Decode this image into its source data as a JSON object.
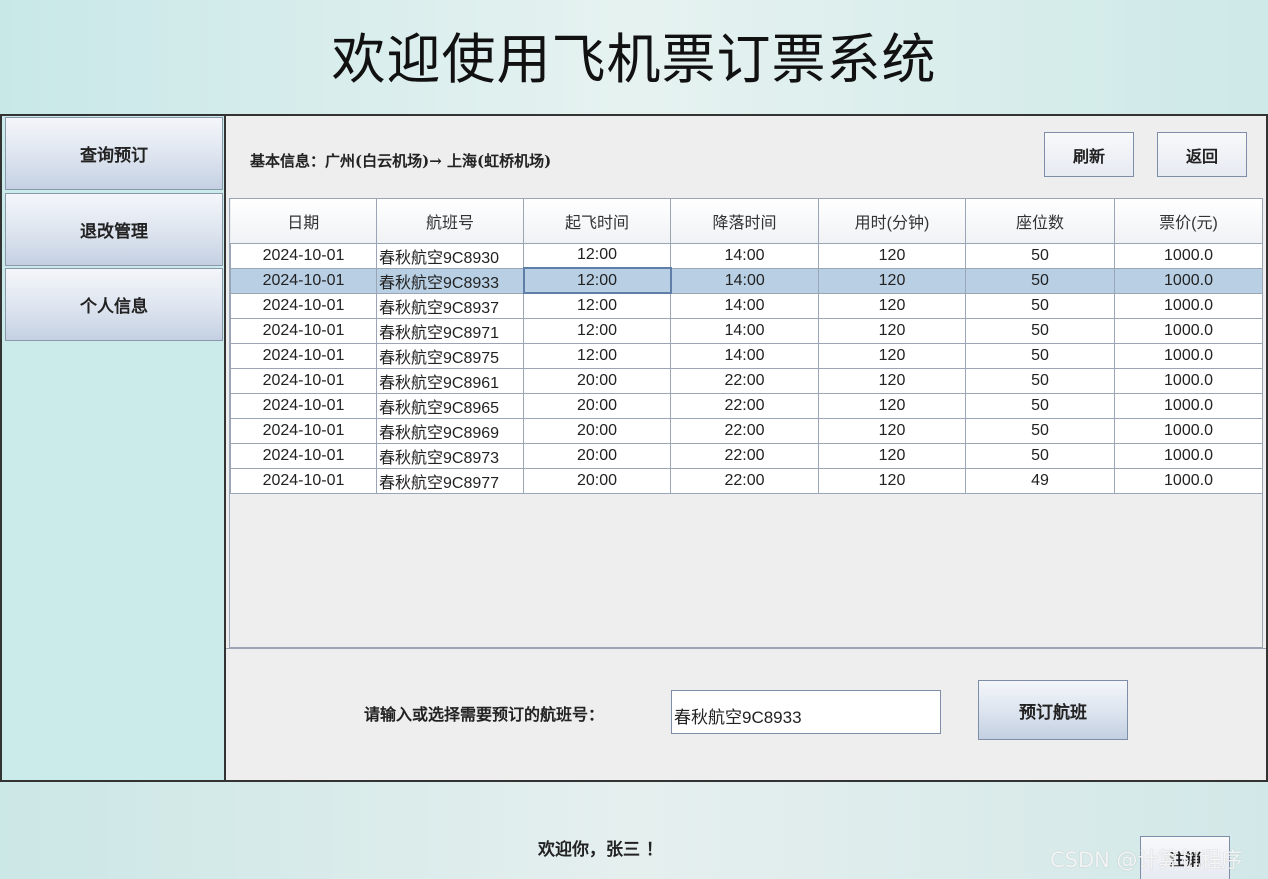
{
  "header": {
    "title": "欢迎使用飞机票订票系统"
  },
  "sidebar": {
    "items": [
      {
        "label": "查询预订"
      },
      {
        "label": "退改管理"
      },
      {
        "label": "个人信息"
      }
    ]
  },
  "main": {
    "info_label": "基本信息：广州(白云机场)→ 上海(虹桥机场)",
    "refresh_label": "刷新",
    "back_label": "返回",
    "table": {
      "columns": [
        "日期",
        "航班号",
        "起飞时间",
        "降落时间",
        "用时(分钟)",
        "座位数",
        "票价(元)"
      ],
      "rows": [
        [
          "2024-10-01",
          "春秋航空9C8930",
          "12:00",
          "14:00",
          "120",
          "50",
          "1000.0"
        ],
        [
          "2024-10-01",
          "春秋航空9C8933",
          "12:00",
          "14:00",
          "120",
          "50",
          "1000.0"
        ],
        [
          "2024-10-01",
          "春秋航空9C8937",
          "12:00",
          "14:00",
          "120",
          "50",
          "1000.0"
        ],
        [
          "2024-10-01",
          "春秋航空9C8971",
          "12:00",
          "14:00",
          "120",
          "50",
          "1000.0"
        ],
        [
          "2024-10-01",
          "春秋航空9C8975",
          "12:00",
          "14:00",
          "120",
          "50",
          "1000.0"
        ],
        [
          "2024-10-01",
          "春秋航空9C8961",
          "20:00",
          "22:00",
          "120",
          "50",
          "1000.0"
        ],
        [
          "2024-10-01",
          "春秋航空9C8965",
          "20:00",
          "22:00",
          "120",
          "50",
          "1000.0"
        ],
        [
          "2024-10-01",
          "春秋航空9C8969",
          "20:00",
          "22:00",
          "120",
          "50",
          "1000.0"
        ],
        [
          "2024-10-01",
          "春秋航空9C8973",
          "20:00",
          "22:00",
          "120",
          "50",
          "1000.0"
        ],
        [
          "2024-10-01",
          "春秋航空9C8977",
          "20:00",
          "22:00",
          "120",
          "49",
          "1000.0"
        ]
      ],
      "selected_row": 1
    },
    "booking": {
      "label": "请输入或选择需要预订的航班号：",
      "input_value": "春秋航空9C8933",
      "button_label": "预订航班"
    }
  },
  "footer": {
    "welcome": "欢迎你，张三 ！",
    "logout_label": "注销",
    "watermark": "CSDN @计算机程序"
  }
}
